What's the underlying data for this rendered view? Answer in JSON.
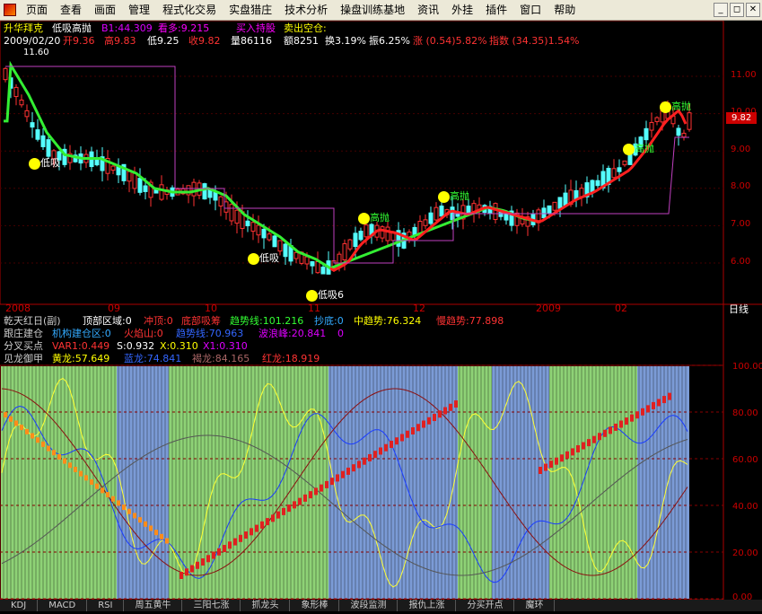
{
  "menubar": {
    "items": [
      "页面",
      "查看",
      "画面",
      "管理",
      "程式化交易",
      "实盘猎庄",
      "技术分析",
      "操盘训练基地",
      "资讯",
      "外挂",
      "插件",
      "窗口",
      "帮助"
    ]
  },
  "window_controls": [
    "_",
    "◻",
    "✕"
  ],
  "stock": {
    "name": "升华拜克",
    "indicator": "低吸高抛",
    "b1_label": "B1:44.309",
    "bull": "看多:9.215",
    "buy_hold": "买入持股",
    "sell_empty": "卖出空仓:"
  },
  "quote": {
    "date": "2009/02/20",
    "open": "开9.36",
    "high": "高9.83",
    "low": "低9.25",
    "close": "收9.82",
    "volume": "量86116",
    "amount": "额8251",
    "turnover": "换3.19%",
    "amplitude": "振6.25%",
    "change": "涨 (0.54)5.82%",
    "index": "指数 (34.35)1.54%"
  },
  "price_axis": {
    "ticks": [
      "11.00",
      "10.00",
      "9.00",
      "8.00",
      "7.00",
      "6.00"
    ],
    "current": "9.82",
    "high_mark": "11.60",
    "period": "日线"
  },
  "time_axis": [
    "2008",
    "09",
    "10",
    "11",
    "12",
    "2009",
    "02"
  ],
  "signals": {
    "low_buy": "低吸",
    "low_buy6": "低吸6",
    "high_sell": "高抛"
  },
  "indicator_rows": {
    "row1": {
      "name": "乾天红日(副)",
      "top_zone": "顶部区域:0",
      "chongding": "冲顶:0",
      "bottom_chip": "底部吸筹",
      "trend_line": "趋势线:101.216",
      "chaodie": "抄底:0",
      "mid_trend": "中趋势:76.324",
      "slow_trend": "慢趋势:77.898"
    },
    "row2": {
      "name": "跟庄建仓",
      "inst_zone": "机构建仓区:0",
      "volcano": "火焰山:0",
      "trend_wave": "趋势线:70.963",
      "wave_peak": "波浪峰:20.841",
      "v0": "0"
    },
    "row3": {
      "name": "分叉买点",
      "var1": "VAR1:0.449",
      "s": "S:0.932",
      "x": "X:0.310",
      "x1": "X1:0.310"
    },
    "row4": {
      "name": "见龙御甲",
      "yellow": "黄龙:57.649",
      "blue": "蓝龙:74.841",
      "brown": "褐龙:84.165",
      "red": "红龙:18.919"
    }
  },
  "sub_axis": [
    "100.00",
    "80.00",
    "60.00",
    "40.00",
    "20.00",
    "0.00"
  ],
  "bottom_tabs": [
    "KDJ",
    "MACD",
    "RSI",
    "周五黄牛",
    "三阳七涨",
    "抓龙头",
    "象形棒",
    "波段监测",
    "报仇上涨",
    "分买开点",
    "魔环"
  ],
  "colors": {
    "up": "#ff3232",
    "down": "#54ffff",
    "ma_green": "#33ee33",
    "ma_red": "#ff2020",
    "purple": "#c040c0",
    "bg_green": "#8ed276",
    "bg_blue": "#7b9bd6"
  }
}
